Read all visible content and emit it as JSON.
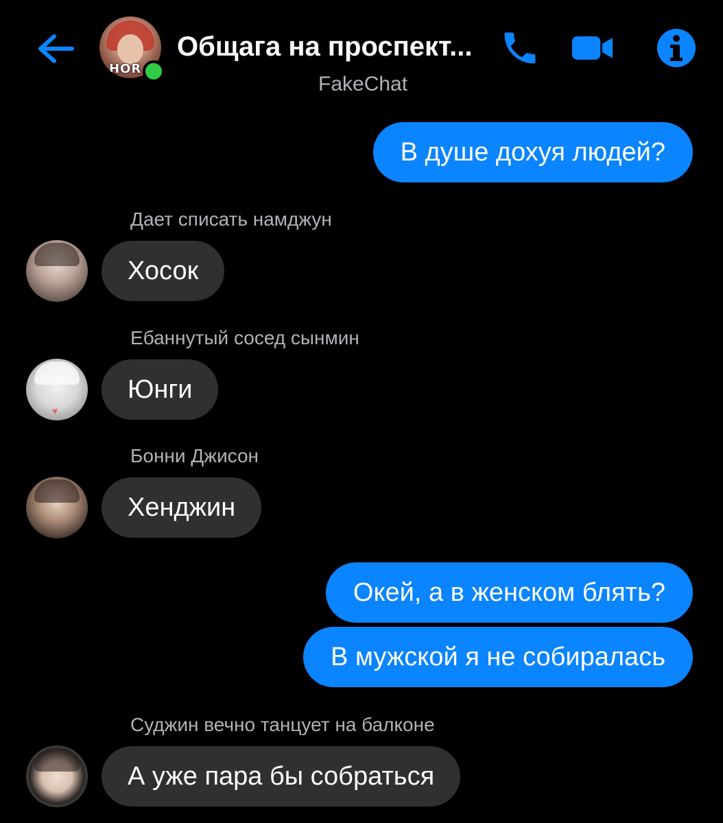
{
  "header": {
    "title": "Общага на проспект...",
    "subtitle": "FakeChat",
    "group_avatar_caption": "HOR",
    "icons": {
      "back": "arrow-left-icon",
      "call": "phone-icon",
      "video": "video-camera-icon",
      "info": "info-icon"
    },
    "accent_color": "#0a84ff",
    "online_color": "#31cc46"
  },
  "messages": {
    "out_1": "В душе дохуя людей?",
    "in_1": {
      "sender": "Дает списать намджун",
      "text": "Хосок"
    },
    "in_2": {
      "sender": "Ебаннутый сосед сынмин",
      "text": "Юнги"
    },
    "in_3": {
      "sender": "Бонни Джисон",
      "text": "Хенджин"
    },
    "out_2": "Окей, а в женском блять?",
    "out_3": "В мужской я не собиралась",
    "in_4": {
      "sender": "Суджин вечно танцует на балконе",
      "text": "А уже пара бы собраться"
    }
  }
}
